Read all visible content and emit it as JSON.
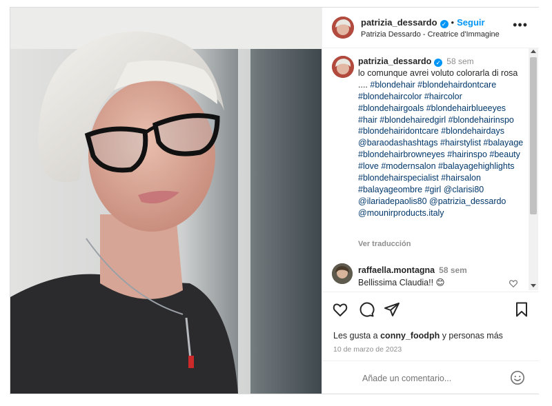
{
  "post": {
    "username": "patrizia_dessardo",
    "follow_label": "Seguir",
    "dot": "•",
    "subtitle": "Patrizia Dessardo - Creatrice d'Immagine",
    "more_label": "•••"
  },
  "caption": {
    "username": "patrizia_dessardo",
    "time": "58 sem",
    "text": "lo comunque avrei voluto colorarla di rosa .... ",
    "hashtags": "#blondehair #blondehairdontcare #blondehaircolor #haircolor #blondehairgoals #blondehairblueeyes #hair #blondehairedgirl #blondehairinspo #blondehairidontcare #blondehairdays @baraodashashtags #hairstylist #balayage #blondehairbrowneyes #hairinspo #beauty #love #modernsalon #balayagehighlights #blondehairspecialist #hairsalon #balayageombre #girl @clarisi80 @ilariadepaolis80 @patrizia_dessardo @mounirproducts.italy",
    "translate_label": "Ver traducción"
  },
  "comment": {
    "username": "raffaella.montagna",
    "time": "58 sem",
    "text": "Bellissima Claudia!! 😊"
  },
  "likes": {
    "prefix": "Les gusta a ",
    "user": "conny_foodph",
    "suffix": " y personas más"
  },
  "date": "10 de marzo de 2023",
  "add_comment": {
    "placeholder": "Añade un comentario..."
  },
  "icons": {
    "like": "heart-icon",
    "comment": "comment-icon",
    "share": "share-icon",
    "save": "bookmark-icon",
    "emoji": "emoji-icon",
    "more": "more-icon",
    "verified": "verified-icon"
  },
  "colors": {
    "link_blue": "#0095f6",
    "hashtag": "#00376b",
    "muted": "#8e8e8e"
  }
}
